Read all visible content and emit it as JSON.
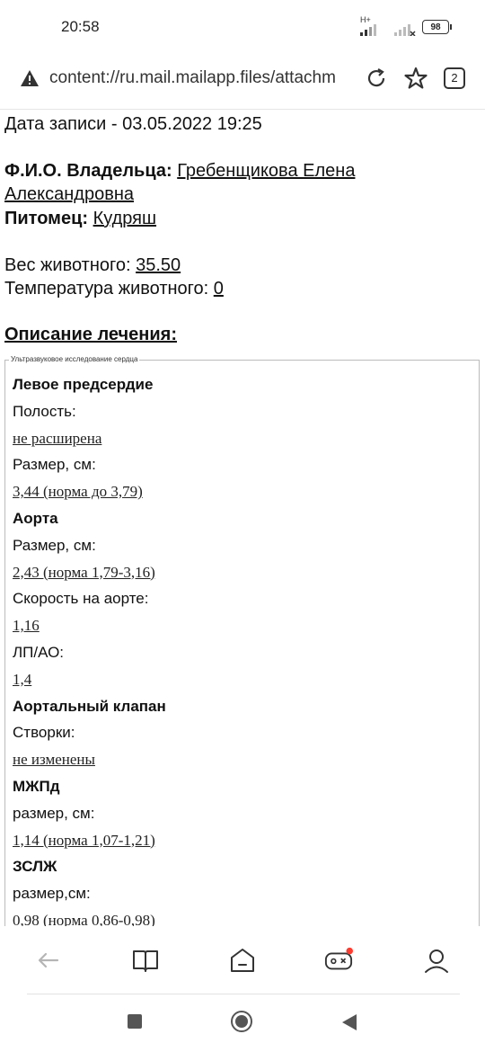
{
  "status_bar": {
    "time": "20:58",
    "network_label": "H+",
    "battery": "98"
  },
  "address_bar": {
    "url": "content://ru.mail.mailapp.files/attachm",
    "tab_count": "2",
    "icons": [
      "warning-icon",
      "reload-icon",
      "star-icon",
      "tabs-icon"
    ]
  },
  "record": {
    "date_line": "Дата записи - 03.05.2022 19:25",
    "owner_label": "Ф.И.О. Владельца:",
    "owner_name_part1": "Гребенщикова Елена",
    "owner_name_part2": "Александровна",
    "pet_label": "Питомец:",
    "pet_name": "Кудряш",
    "weight_label": "Вес животного:",
    "weight_value": "35.50",
    "temp_label": "Температура животного:",
    "temp_value": "0",
    "description_title": "Описание лечения:"
  },
  "exam": {
    "legend": "Ультразвуковое исследование сердца",
    "rows": [
      {
        "kind": "heading",
        "text": "Левое предсердие"
      },
      {
        "kind": "label",
        "text": "Полость:"
      },
      {
        "kind": "value",
        "text": "не расширена"
      },
      {
        "kind": "label",
        "text": "Размер, см:"
      },
      {
        "kind": "value",
        "text": "3,44 (норма до 3,79)"
      },
      {
        "kind": "heading",
        "text": "Аорта"
      },
      {
        "kind": "label",
        "text": "Размер, см:"
      },
      {
        "kind": "value",
        "text": "2,43 (норма 1,79-3,16)"
      },
      {
        "kind": "label",
        "text": "Скорость на аорте:"
      },
      {
        "kind": "value",
        "text": "1,16"
      },
      {
        "kind": "label",
        "text": "ЛП/АО:"
      },
      {
        "kind": "value",
        "text": "1,4"
      },
      {
        "kind": "heading",
        "text": "Аортальный клапан"
      },
      {
        "kind": "label",
        "text": "Створки:"
      },
      {
        "kind": "value",
        "text": "не изменены"
      },
      {
        "kind": "heading",
        "text": "МЖПд"
      },
      {
        "kind": "label",
        "text": "размер, см:"
      },
      {
        "kind": "value",
        "text": "1,14 (норма 1,07-1,21)"
      },
      {
        "kind": "heading",
        "text": "ЗСЛЖ"
      },
      {
        "kind": "label",
        "text": "размер,см:"
      },
      {
        "kind": "value",
        "text": "0,98 (норма 0,86-0,98)"
      }
    ]
  },
  "bottom_nav": {
    "icons": [
      "back-arrow-icon",
      "book-icon",
      "home-icon",
      "gamepad-icon",
      "profile-icon"
    ],
    "notification_color": "#ff3b30"
  },
  "system_nav": {
    "icons": [
      "recents-square-icon",
      "home-circle-icon",
      "back-triangle-icon"
    ]
  },
  "colors": {
    "text": "#111111",
    "icon": "#333333",
    "muted_icon": "#b5b5b5"
  }
}
